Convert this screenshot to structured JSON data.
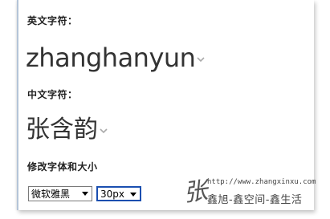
{
  "section_english": {
    "label": "英文字符：",
    "sample": "zhanghanyun"
  },
  "section_chinese": {
    "label": "中文字符：",
    "sample": "张含韵"
  },
  "section_change_font": {
    "label": "修改字体和大小"
  },
  "controls": {
    "font_select_value": "微软雅黑",
    "size_select_value": "30px"
  },
  "watermark": {
    "char": "张",
    "url": "http://www.zhangxinxu.com",
    "slogan": "鑫旭-鑫空间-鑫生活"
  },
  "icons": {
    "dropdown": "chevron-down-icon"
  },
  "colors": {
    "frame_border": "#b4c4d8",
    "text": "#333333",
    "select_focus": "#1a4fb0"
  }
}
